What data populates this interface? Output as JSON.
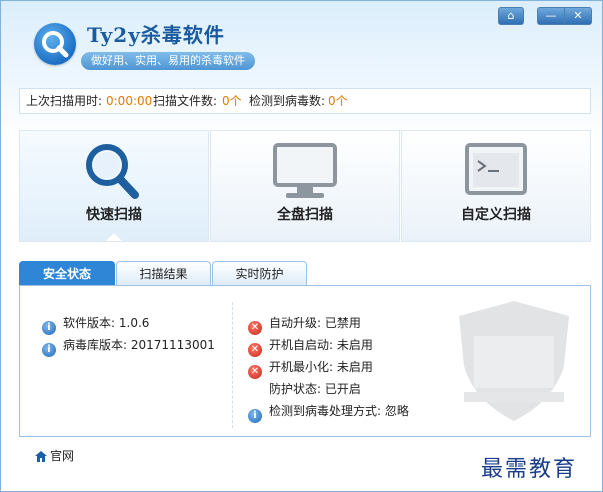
{
  "header": {
    "title": "Ty2y杀毒软件",
    "subtitle": "做好用、实用、易用的杀毒软件"
  },
  "window_buttons": {
    "skin": "⌂",
    "minimize": "—",
    "close": "✕"
  },
  "stats": {
    "last_scan_label": "上次扫描用时:",
    "last_scan_value": "0:00:00",
    "files_label": "扫描文件数:",
    "files_value": "0个",
    "virus_label": "检测到病毒数:",
    "virus_value": "0个"
  },
  "scan_modes": {
    "quick": "快速扫描",
    "full": "全盘扫描",
    "custom": "自定义扫描"
  },
  "tabs": [
    "安全状态",
    "扫描结果",
    "实时防护"
  ],
  "status_left": [
    {
      "label": "软件版本:",
      "value": "1.0.6"
    },
    {
      "label": "病毒库版本:",
      "value": "20171113001"
    }
  ],
  "status_right": [
    {
      "icon": "error-icon",
      "text": "自动升级: 已禁用"
    },
    {
      "icon": "error-icon",
      "text": "开机自启动: 未启用"
    },
    {
      "icon": "error-icon",
      "text": "开机最小化: 未启用"
    },
    {
      "icon": "",
      "text": "防护状态: 已开启"
    },
    {
      "icon": "info-icon",
      "text": "检测到病毒处理方式: 忽略"
    }
  ],
  "footer": {
    "home_label": "官网"
  },
  "watermark": "最需教育",
  "colors": {
    "accent": "#2f86d6",
    "value": "#e07a00",
    "error": "#c4261b"
  }
}
